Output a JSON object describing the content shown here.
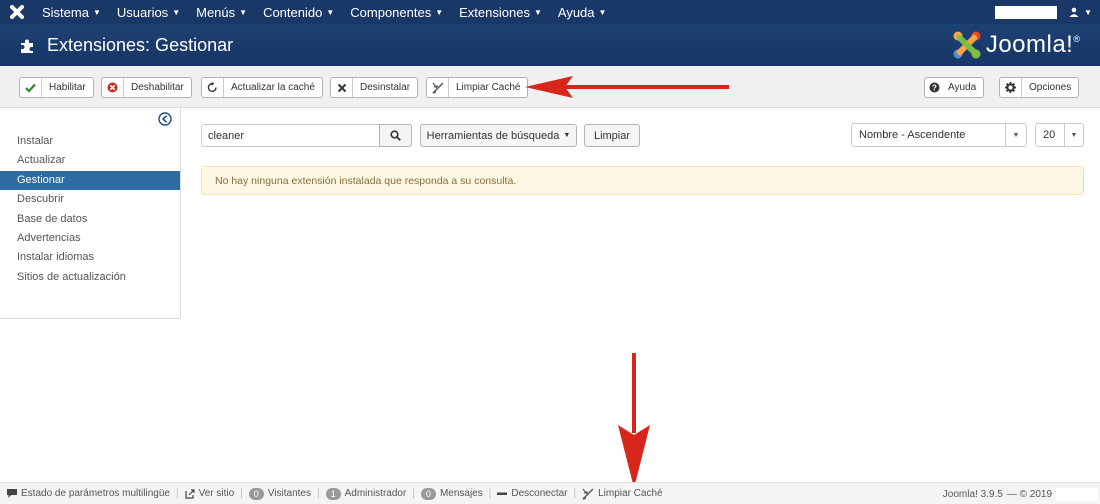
{
  "topbar": {
    "menu": [
      {
        "label": "Sistema"
      },
      {
        "label": "Usuarios"
      },
      {
        "label": "Menús"
      },
      {
        "label": "Contenido"
      },
      {
        "label": "Componentes"
      },
      {
        "label": "Extensiones"
      },
      {
        "label": "Ayuda"
      }
    ],
    "user_icon": "user-icon"
  },
  "header": {
    "title": "Extensiones: Gestionar",
    "brand": "Joomla!",
    "brand_mark": "®"
  },
  "toolbar": {
    "enable": "Habilitar",
    "disable": "Deshabilitar",
    "refresh_cache": "Actualizar la caché",
    "uninstall": "Desinstalar",
    "clear_cache": "Limpiar Caché",
    "help": "Ayuda",
    "options": "Opciones"
  },
  "sidebar": {
    "items": [
      {
        "label": "Instalar",
        "active": false
      },
      {
        "label": "Actualizar",
        "active": false
      },
      {
        "label": "Gestionar",
        "active": true
      },
      {
        "label": "Descubrir",
        "active": false
      },
      {
        "label": "Base de datos",
        "active": false
      },
      {
        "label": "Advertencias",
        "active": false
      },
      {
        "label": "Instalar idiomas",
        "active": false
      },
      {
        "label": "Sitios de actualización",
        "active": false
      }
    ]
  },
  "filters": {
    "search_value": "cleaner",
    "search_tools": "Herramientas de búsqueda",
    "clear": "Limpiar",
    "sort": "Nombre - Ascendente",
    "limit": "20"
  },
  "alert": {
    "message": "No hay ninguna extensión instalada que responda a su consulta."
  },
  "statusbar": {
    "multilang": "Estado de parámetros multilingüe",
    "view_site": "Ver sitio",
    "visitors_count": "0",
    "visitors": "Visitantes",
    "admins_count": "1",
    "admins": "Administrador",
    "messages_count": "0",
    "messages": "Mensajes",
    "logout": "Desconectar",
    "clear_cache": "Limpiar Caché",
    "version": "Joomla! 3.9.5",
    "copyright": "— © 2019"
  },
  "colors": {
    "nav": "#1a3867",
    "header": "#1c3d6e",
    "active": "#2d6ca2",
    "alert_bg": "#fcf8e3",
    "arrow": "#d9261c"
  }
}
